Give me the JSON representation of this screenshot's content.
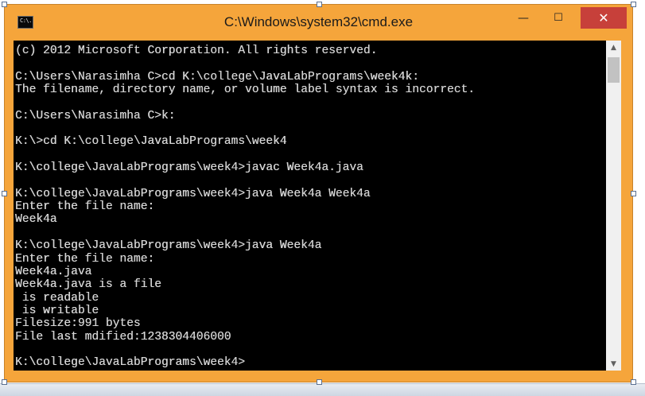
{
  "window": {
    "title": "C:\\Windows\\system32\\cmd.exe",
    "icon": "cmd-icon",
    "icon_label": "C:\\.",
    "accent_color": "#f5a53b",
    "close_color": "#c7403a",
    "minimize_glyph": "—",
    "maximize_glyph": "☐",
    "close_glyph": "✕"
  },
  "console": {
    "background": "#000000",
    "foreground": "#d4d4d4",
    "lines": [
      "(c) 2012 Microsoft Corporation. All rights reserved.",
      "",
      "C:\\Users\\Narasimha C>cd K:\\college\\JavaLabPrograms\\week4k:",
      "The filename, directory name, or volume label syntax is incorrect.",
      "",
      "C:\\Users\\Narasimha C>k:",
      "",
      "K:\\>cd K:\\college\\JavaLabPrograms\\week4",
      "",
      "K:\\college\\JavaLabPrograms\\week4>javac Week4a.java",
      "",
      "K:\\college\\JavaLabPrograms\\week4>java Week4a Week4a",
      "Enter the file name:",
      "Week4a",
      "",
      "K:\\college\\JavaLabPrograms\\week4>java Week4a",
      "Enter the file name:",
      "Week4a.java",
      "Week4a.java is a file",
      " is readable",
      " is writable",
      "Filesize:991 bytes",
      "File last mdified:1238304406000",
      "",
      "K:\\college\\JavaLabPrograms\\week4>"
    ]
  },
  "scrollbar": {
    "up_glyph": "▲",
    "down_glyph": "▼"
  }
}
